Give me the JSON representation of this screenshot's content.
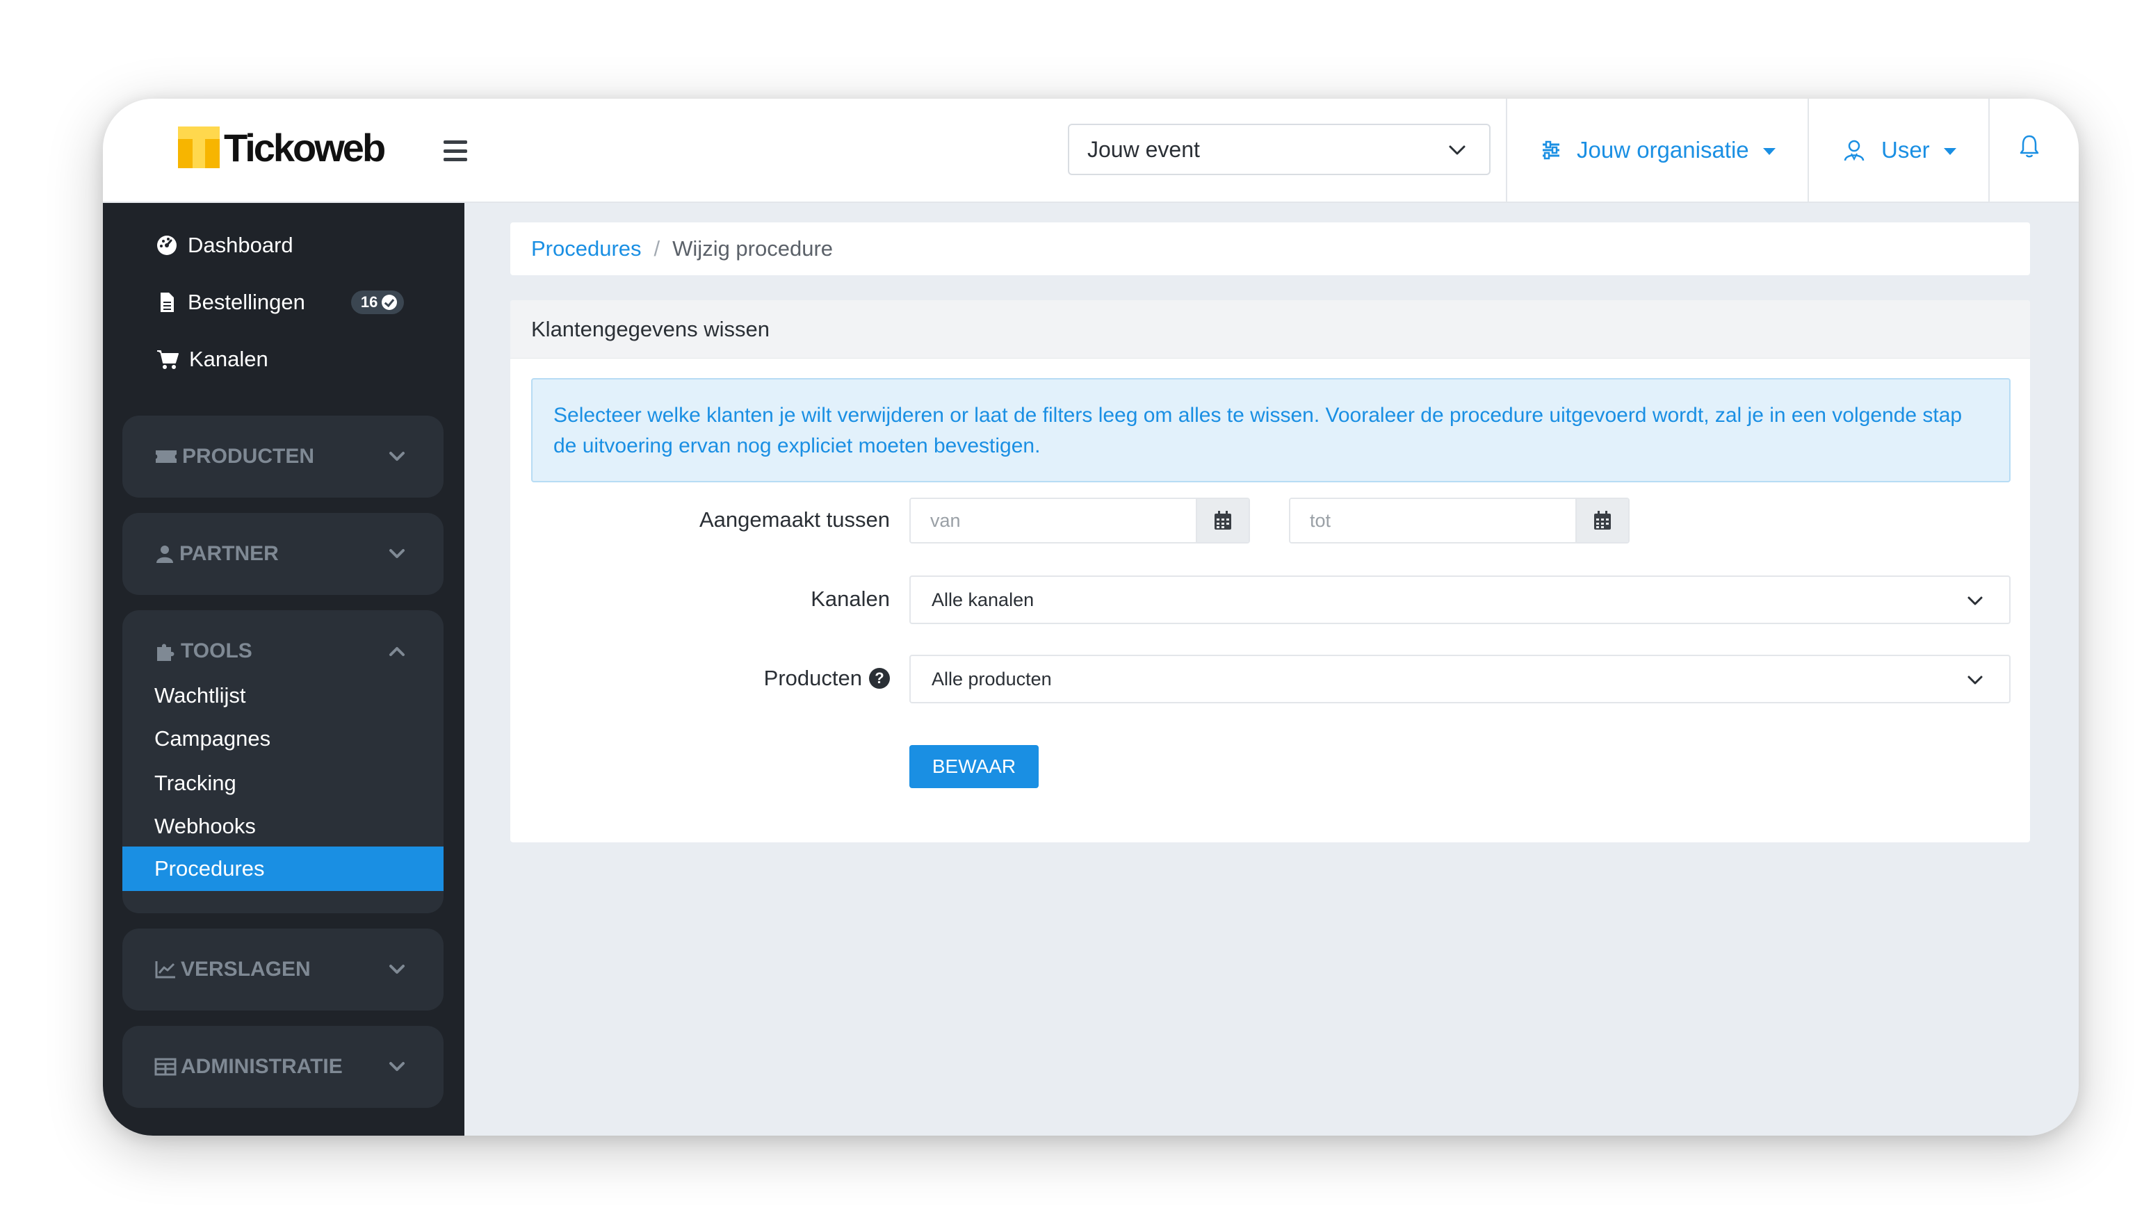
{
  "header": {
    "logo_text": "Tickoweb",
    "event_select": "Jouw event",
    "organisation": "Jouw organisatie",
    "user": "User"
  },
  "sidebar": {
    "top_items": [
      {
        "label": "Dashboard",
        "icon": "dashboard-icon"
      },
      {
        "label": "Bestellingen",
        "icon": "file-icon",
        "badge": "16"
      },
      {
        "label": "Kanalen",
        "icon": "cart-icon"
      }
    ],
    "groups": [
      {
        "label": "PRODUCTEN",
        "icon": "ticket-icon",
        "expanded": false
      },
      {
        "label": "PARTNER",
        "icon": "partner-icon",
        "expanded": false
      },
      {
        "label": "TOOLS",
        "icon": "puzzle-icon",
        "expanded": true,
        "items": [
          "Wachtlijst",
          "Campagnes",
          "Tracking",
          "Webhooks",
          "Procedures"
        ],
        "active": "Procedures"
      },
      {
        "label": "VERSLAGEN",
        "icon": "chart-icon",
        "expanded": false
      },
      {
        "label": "ADMINISTRATIE",
        "icon": "table-icon",
        "expanded": false
      }
    ]
  },
  "breadcrumb": {
    "link": "Procedures",
    "separator": "/",
    "current": "Wijzig procedure"
  },
  "card": {
    "title": "Klantengegevens wissen",
    "info": "Selecteer welke klanten je wilt verwijderen or laat de filters leeg om alles te wissen. Vooraleer de procedure uitgevoerd wordt, zal je in een volgende stap de uitvoering ervan nog expliciet moeten bevestigen.",
    "created_label": "Aangemaakt tussen",
    "from_placeholder": "van",
    "to_placeholder": "tot",
    "channels_label": "Kanalen",
    "channels_value": "Alle kanalen",
    "products_label": "Producten",
    "products_value": "Alle producten",
    "help_glyph": "?",
    "save_label": "BEWAAR"
  },
  "colors": {
    "accent": "#1a8fe3",
    "sidebar_bg": "#1f2329",
    "sidebar_group_bg": "#2a3038",
    "info_bg": "#e2f1fb"
  }
}
